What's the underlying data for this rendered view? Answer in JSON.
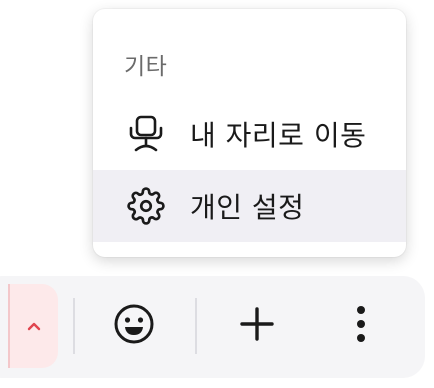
{
  "menu": {
    "section_label": "기타",
    "items": [
      {
        "label": "내 자리로 이동",
        "icon": "office-chair-icon"
      },
      {
        "label": "개인 설정",
        "icon": "gear-icon"
      }
    ]
  },
  "toolbar": {
    "buttons": [
      "chevron-up-icon",
      "emoji-icon",
      "plus-icon",
      "more-vertical-icon"
    ]
  }
}
